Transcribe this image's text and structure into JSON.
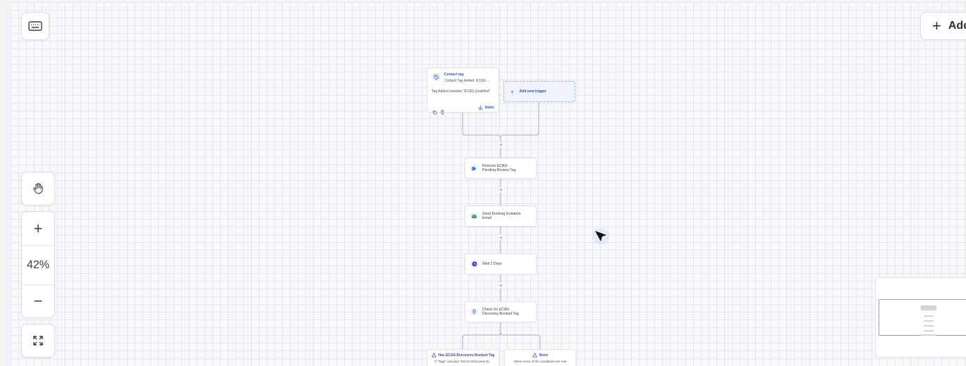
{
  "trigger": {
    "title": "Contact tag",
    "subtitle": "Contact Tag Added: ECAS-...",
    "condition": "Tag Added includes \"ECAS-Qualified\"",
    "stats_label": "Stats"
  },
  "add_trigger": {
    "label": "Add new trigger"
  },
  "actions": [
    {
      "label": "Remove ECAS-Pending-Review Tag",
      "icon": "tag-remove-icon",
      "color": "#2f5bd8"
    },
    {
      "label": "Send Booking Invitation Email",
      "icon": "email-icon",
      "color": "#16803c"
    },
    {
      "label": "Wait 2 Days",
      "icon": "clock-icon",
      "color": "#5b35c9"
    },
    {
      "label": "Check for ECAS-Discovery-Booked Tag",
      "icon": "condition-icon",
      "color": "#2f5bd8"
    }
  ],
  "branches": [
    {
      "title": "Has ECAS-Discovery-Booked Tag",
      "subtitle": "If \"Tags\" includes \"ECAS-Discovery-B..."
    },
    {
      "title": "None",
      "subtitle": "When none of the conditions are met"
    }
  ],
  "toolbar": {
    "add_label": "Add",
    "zoom_level": "42%",
    "zoom_in_symbol": "+",
    "zoom_out_symbol": "−"
  },
  "more_dots": "···",
  "plus_symbol": "+",
  "colors": {
    "accent": "#2f5bd8",
    "branch": "#5b35c9",
    "add_trigger_bg": "#eef3fd",
    "add_trigger_border": "#9fb4ea"
  }
}
